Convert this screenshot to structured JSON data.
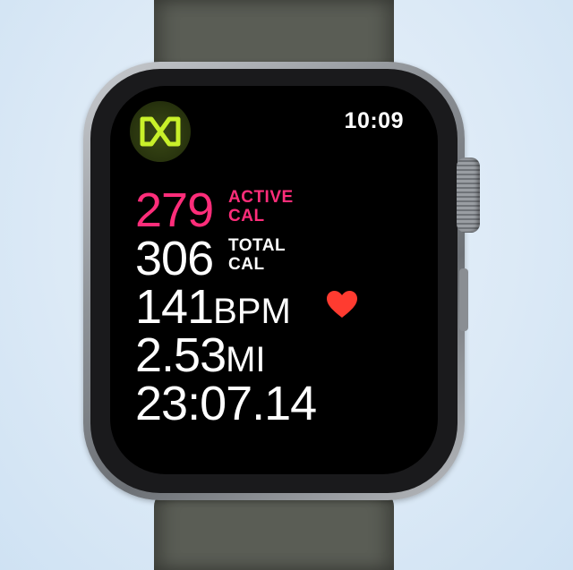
{
  "status": {
    "time": "10:09"
  },
  "app": {
    "icon": "workout-app-icon"
  },
  "metrics": {
    "active": {
      "value": "279",
      "label_line1": "ACTIVE",
      "label_line2": "CAL"
    },
    "total": {
      "value": "306",
      "label_line1": "TOTAL",
      "label_line2": "CAL"
    },
    "heart_rate": {
      "value": "141",
      "unit": "BPM",
      "icon": "heart-icon"
    },
    "distance": {
      "value": "2.53",
      "unit": "MI"
    },
    "elapsed": {
      "value": "23:07.14"
    }
  },
  "colors": {
    "active_pink": "#ff2d7a",
    "heart_red": "#ff3b30",
    "icon_green": "#c8f02a",
    "band": "#5a5d55"
  }
}
